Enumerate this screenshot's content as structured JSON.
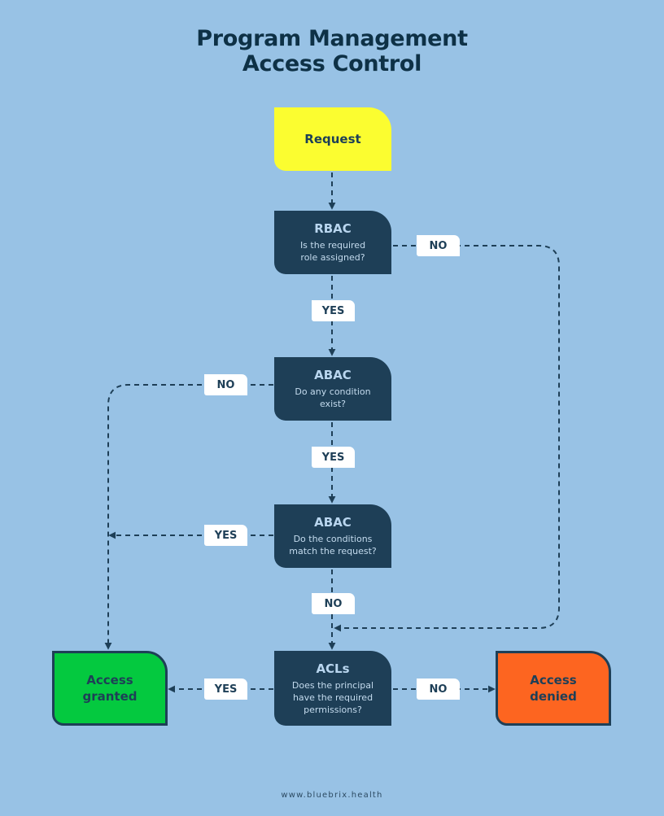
{
  "title": {
    "line1": "Program Management",
    "line2": "Access Control"
  },
  "nodes": {
    "request": {
      "label": "Request"
    },
    "rbac": {
      "head": "RBAC",
      "question": "Is the required role assigned?"
    },
    "abac1": {
      "head": "ABAC",
      "question": "Do any condition exist?"
    },
    "abac2": {
      "head": "ABAC",
      "question": "Do the conditions match the request?"
    },
    "acls": {
      "head": "ACLs",
      "question": "Does the principal have the required permissions?"
    },
    "granted": {
      "label": "Access granted"
    },
    "denied": {
      "label": "Access denied"
    }
  },
  "edges": {
    "rbac_no": "NO",
    "rbac_yes": "YES",
    "abac1_no": "NO",
    "abac1_yes": "YES",
    "abac2_yes": "YES",
    "abac2_no": "NO",
    "acls_yes": "YES",
    "acls_no": "NO"
  },
  "colors": {
    "background": "#98c2e5",
    "decision": "#1e3f57",
    "start": "#fbfd30",
    "granted": "#04c93f",
    "denied": "#fd6520"
  },
  "footer": "www.bluebrix.health"
}
